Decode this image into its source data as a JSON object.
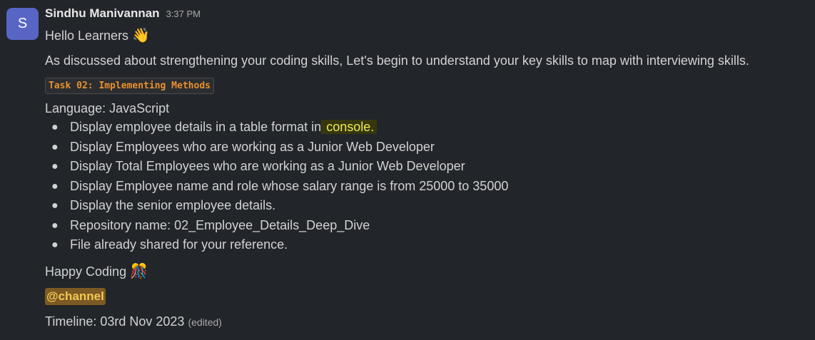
{
  "message": {
    "avatar_initial": "S",
    "sender": "Sindhu Manivannan",
    "time": "3:37 PM",
    "greeting": "Hello Learners",
    "greeting_emoji": "👋",
    "intro": "As discussed about strengthening your coding skills, Let's begin to understand your key skills to map with interviewing skills.",
    "task_code": "Task 02: Implementing Methods",
    "language": "Language: JavaScript",
    "items": [
      {
        "prefix": "Display employee details in a table format in",
        "highlight": " console."
      },
      {
        "text": "Display Employees who are working as a Junior Web Developer"
      },
      {
        "text": "Display Total Employees who are working as a Junior Web Developer"
      },
      {
        "text": "Display Employee name and role whose salary range is from 25000 to 35000"
      },
      {
        "text": "Display the senior employee details."
      },
      {
        "text": "Repository name: 02_Employee_Details_Deep_Dive"
      },
      {
        "text": "File already shared for your reference."
      }
    ],
    "happy": "Happy Coding",
    "happy_emoji": "🎊",
    "mention": "@channel",
    "timeline": "Timeline: 03rd Nov 2023",
    "edited": "(edited)"
  },
  "colors": {
    "background": "#222529",
    "avatar": "#5865c4",
    "code_text": "#e8912d",
    "highlight_bg": "#36370f",
    "highlight_text": "#f2ea4d",
    "mention_bg": "#7b5a24",
    "mention_text": "#f5c653"
  }
}
